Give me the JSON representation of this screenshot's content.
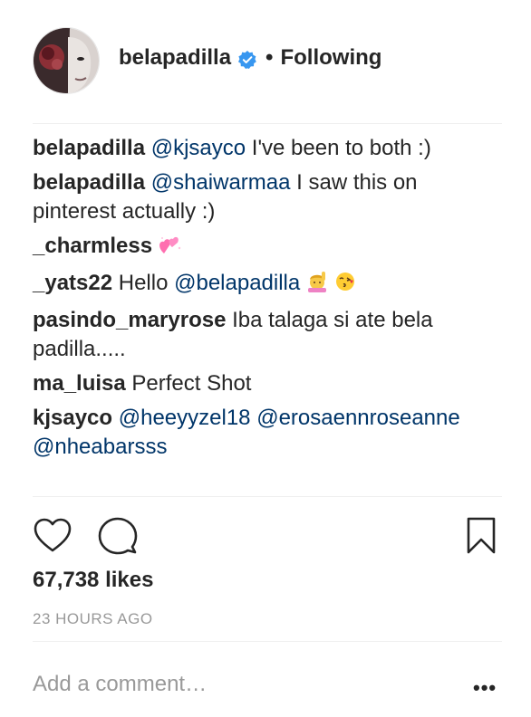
{
  "header": {
    "username": "belapadilla",
    "separator": "•",
    "follow_status": "Following",
    "verified_color": "#3897f0"
  },
  "comments": [
    {
      "user": "belapadilla",
      "mention": "@kjsayco",
      "text": " I've been to both :)"
    },
    {
      "user": "belapadilla",
      "mention": "@shaiwarmaa",
      "text": " I saw this on pinterest actually :)"
    },
    {
      "user": "_charmless",
      "mention": "",
      "text": "",
      "emoji": "sparkling-heart"
    },
    {
      "user": "_yats22",
      "text": "Hello ",
      "mention": "@belapadilla",
      "emoji": "raising-hand-and-kiss"
    },
    {
      "user": "pasindo_maryrose",
      "mention": "",
      "text": "Iba talaga si ate bela padilla....."
    },
    {
      "user": "ma_luisa",
      "mention": "",
      "text": "Perfect Shot"
    },
    {
      "user": "kjsayco",
      "mention": "@heeyyzel18 @erosaennroseanne @nheabarsss",
      "text": ""
    }
  ],
  "actions": {
    "like_icon": "heart-icon",
    "comment_icon": "comment-bubble-icon",
    "save_icon": "bookmark-icon"
  },
  "likes": "67,738 likes",
  "timestamp": "23 HOURS AGO",
  "comment_input": {
    "placeholder": "Add a comment…"
  },
  "more_label": "•••",
  "colors": {
    "mention": "#003569",
    "muted": "#999999",
    "separator": "#efefef"
  }
}
